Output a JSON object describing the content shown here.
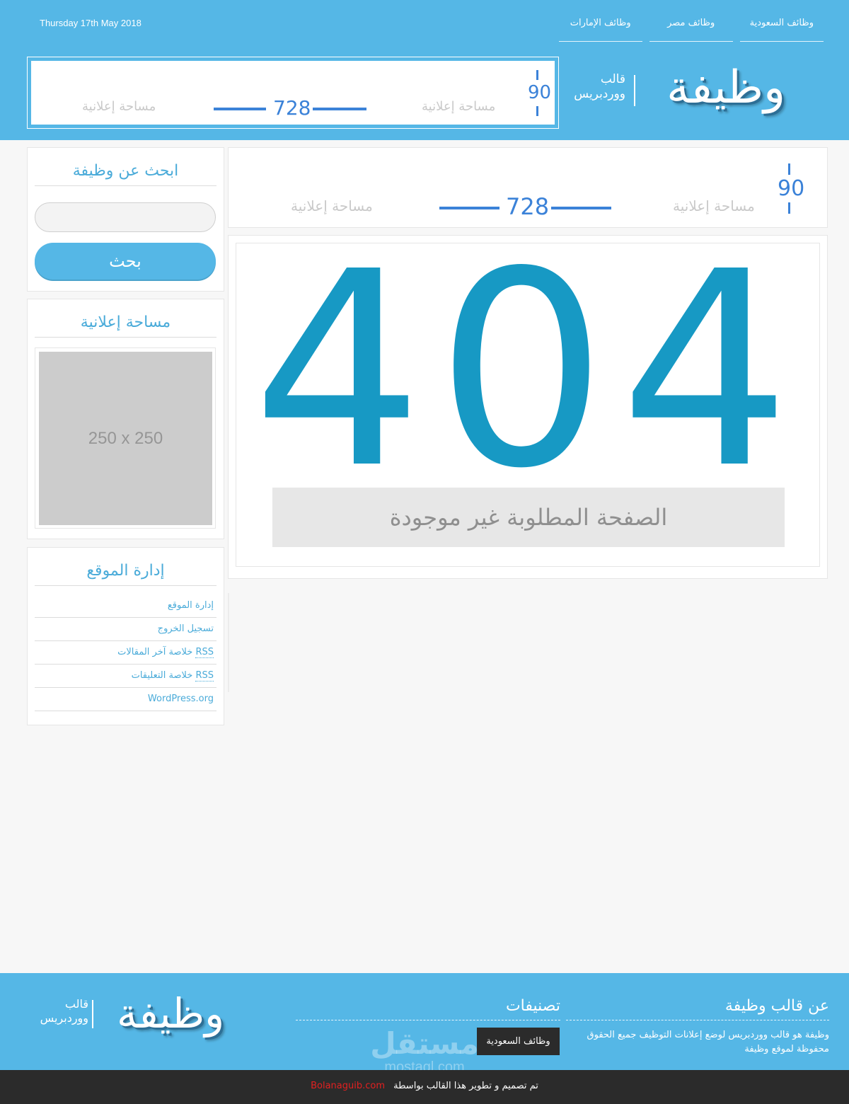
{
  "header": {
    "date": "Thursday 17th May 2018",
    "nav": [
      "وظائف السعودية",
      "وظائف مصر",
      "وظائف الإمارات"
    ],
    "logo": {
      "title": "وظيفة",
      "subtitle_line1": "قالب",
      "subtitle_line2": "ووردبريس"
    },
    "ad": {
      "height_label": "90",
      "width_label": "728",
      "label": "مساحة إعلانية"
    }
  },
  "content_ad": {
    "height_label": "90",
    "width_label": "728",
    "label": "مساحة إعلانية"
  },
  "error": {
    "code": "404",
    "message": "الصفحة المطلوبة غير موجودة"
  },
  "sidebar": {
    "search": {
      "title": "ابحث عن وظيفة",
      "button": "بحث",
      "placeholder": ""
    },
    "ad": {
      "title": "مساحة إعلانية",
      "size_text": "250 x 250"
    },
    "meta": {
      "title": "إدارة الموقع",
      "items": [
        {
          "text": "إدارة الموقع"
        },
        {
          "text": "تسجيل الخروج"
        },
        {
          "text": "خلاصة آخر المقالات",
          "abbr": "RSS"
        },
        {
          "text": "خلاصة التعليقات",
          "abbr": "RSS"
        },
        {
          "text": "WordPress.org"
        }
      ]
    }
  },
  "footer": {
    "about_title": "عن قالب وظيفة",
    "about_text": "وظيفة هو قالب ووردبريس لوضع إعلانات التوظيف جميع الحقوق محفوظة لموقع وظيفة",
    "categories_title": "تصنيفات",
    "category_tag": "وظائف السعودية",
    "logo": {
      "title": "وظيفة",
      "subtitle_line1": "قالب",
      "subtitle_line2": "ووردبريس"
    },
    "credit_text": "تم تصميم و تطوير هذا القالب بواسطة",
    "credit_link": "Bolanaguib.com"
  },
  "watermark": {
    "arabic": "مستقل",
    "latin": "mostaql.com"
  },
  "colors": {
    "primary": "#55b7e6",
    "accent_404": "#1799c4",
    "ad_blue": "#3b82d8",
    "dark": "#2b2b2b",
    "credit_link": "#e22020"
  }
}
